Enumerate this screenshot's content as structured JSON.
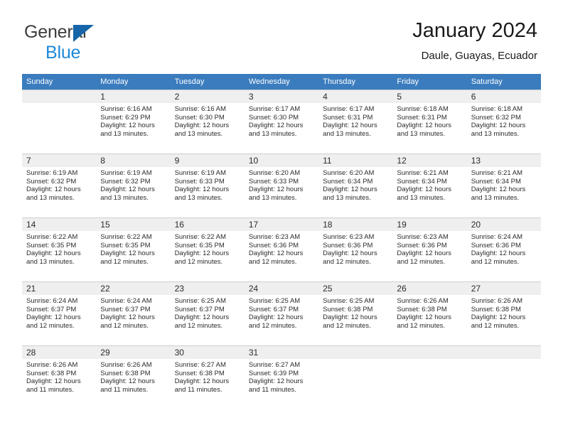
{
  "brand": {
    "line1": "General",
    "line2": "Blue",
    "triangle_color": "#1565a8",
    "blue_text_color": "#1e88d8"
  },
  "header": {
    "title": "January 2024",
    "subtitle": "Daule, Guayas, Ecuador"
  },
  "theme": {
    "header_row_bg": "#3a7cbe",
    "daynum_bg": "#efefef",
    "grid_line": "#cfcfcf"
  },
  "labels": {
    "sunrise_prefix": "Sunrise:",
    "sunset_prefix": "Sunset:",
    "daylight_prefix": "Daylight:"
  },
  "columns": [
    "Sunday",
    "Monday",
    "Tuesday",
    "Wednesday",
    "Thursday",
    "Friday",
    "Saturday"
  ],
  "weeks": [
    [
      {
        "day": "",
        "empty": true
      },
      {
        "day": "1",
        "sunrise": "Sunrise: 6:16 AM",
        "sunset": "Sunset: 6:29 PM",
        "daylight1": "Daylight: 12 hours",
        "daylight2": "and 13 minutes."
      },
      {
        "day": "2",
        "sunrise": "Sunrise: 6:16 AM",
        "sunset": "Sunset: 6:30 PM",
        "daylight1": "Daylight: 12 hours",
        "daylight2": "and 13 minutes."
      },
      {
        "day": "3",
        "sunrise": "Sunrise: 6:17 AM",
        "sunset": "Sunset: 6:30 PM",
        "daylight1": "Daylight: 12 hours",
        "daylight2": "and 13 minutes."
      },
      {
        "day": "4",
        "sunrise": "Sunrise: 6:17 AM",
        "sunset": "Sunset: 6:31 PM",
        "daylight1": "Daylight: 12 hours",
        "daylight2": "and 13 minutes."
      },
      {
        "day": "5",
        "sunrise": "Sunrise: 6:18 AM",
        "sunset": "Sunset: 6:31 PM",
        "daylight1": "Daylight: 12 hours",
        "daylight2": "and 13 minutes."
      },
      {
        "day": "6",
        "sunrise": "Sunrise: 6:18 AM",
        "sunset": "Sunset: 6:32 PM",
        "daylight1": "Daylight: 12 hours",
        "daylight2": "and 13 minutes."
      }
    ],
    [
      {
        "day": "7",
        "sunrise": "Sunrise: 6:19 AM",
        "sunset": "Sunset: 6:32 PM",
        "daylight1": "Daylight: 12 hours",
        "daylight2": "and 13 minutes."
      },
      {
        "day": "8",
        "sunrise": "Sunrise: 6:19 AM",
        "sunset": "Sunset: 6:32 PM",
        "daylight1": "Daylight: 12 hours",
        "daylight2": "and 13 minutes."
      },
      {
        "day": "9",
        "sunrise": "Sunrise: 6:19 AM",
        "sunset": "Sunset: 6:33 PM",
        "daylight1": "Daylight: 12 hours",
        "daylight2": "and 13 minutes."
      },
      {
        "day": "10",
        "sunrise": "Sunrise: 6:20 AM",
        "sunset": "Sunset: 6:33 PM",
        "daylight1": "Daylight: 12 hours",
        "daylight2": "and 13 minutes."
      },
      {
        "day": "11",
        "sunrise": "Sunrise: 6:20 AM",
        "sunset": "Sunset: 6:34 PM",
        "daylight1": "Daylight: 12 hours",
        "daylight2": "and 13 minutes."
      },
      {
        "day": "12",
        "sunrise": "Sunrise: 6:21 AM",
        "sunset": "Sunset: 6:34 PM",
        "daylight1": "Daylight: 12 hours",
        "daylight2": "and 13 minutes."
      },
      {
        "day": "13",
        "sunrise": "Sunrise: 6:21 AM",
        "sunset": "Sunset: 6:34 PM",
        "daylight1": "Daylight: 12 hours",
        "daylight2": "and 13 minutes."
      }
    ],
    [
      {
        "day": "14",
        "sunrise": "Sunrise: 6:22 AM",
        "sunset": "Sunset: 6:35 PM",
        "daylight1": "Daylight: 12 hours",
        "daylight2": "and 13 minutes."
      },
      {
        "day": "15",
        "sunrise": "Sunrise: 6:22 AM",
        "sunset": "Sunset: 6:35 PM",
        "daylight1": "Daylight: 12 hours",
        "daylight2": "and 12 minutes."
      },
      {
        "day": "16",
        "sunrise": "Sunrise: 6:22 AM",
        "sunset": "Sunset: 6:35 PM",
        "daylight1": "Daylight: 12 hours",
        "daylight2": "and 12 minutes."
      },
      {
        "day": "17",
        "sunrise": "Sunrise: 6:23 AM",
        "sunset": "Sunset: 6:36 PM",
        "daylight1": "Daylight: 12 hours",
        "daylight2": "and 12 minutes."
      },
      {
        "day": "18",
        "sunrise": "Sunrise: 6:23 AM",
        "sunset": "Sunset: 6:36 PM",
        "daylight1": "Daylight: 12 hours",
        "daylight2": "and 12 minutes."
      },
      {
        "day": "19",
        "sunrise": "Sunrise: 6:23 AM",
        "sunset": "Sunset: 6:36 PM",
        "daylight1": "Daylight: 12 hours",
        "daylight2": "and 12 minutes."
      },
      {
        "day": "20",
        "sunrise": "Sunrise: 6:24 AM",
        "sunset": "Sunset: 6:36 PM",
        "daylight1": "Daylight: 12 hours",
        "daylight2": "and 12 minutes."
      }
    ],
    [
      {
        "day": "21",
        "sunrise": "Sunrise: 6:24 AM",
        "sunset": "Sunset: 6:37 PM",
        "daylight1": "Daylight: 12 hours",
        "daylight2": "and 12 minutes."
      },
      {
        "day": "22",
        "sunrise": "Sunrise: 6:24 AM",
        "sunset": "Sunset: 6:37 PM",
        "daylight1": "Daylight: 12 hours",
        "daylight2": "and 12 minutes."
      },
      {
        "day": "23",
        "sunrise": "Sunrise: 6:25 AM",
        "sunset": "Sunset: 6:37 PM",
        "daylight1": "Daylight: 12 hours",
        "daylight2": "and 12 minutes."
      },
      {
        "day": "24",
        "sunrise": "Sunrise: 6:25 AM",
        "sunset": "Sunset: 6:37 PM",
        "daylight1": "Daylight: 12 hours",
        "daylight2": "and 12 minutes."
      },
      {
        "day": "25",
        "sunrise": "Sunrise: 6:25 AM",
        "sunset": "Sunset: 6:38 PM",
        "daylight1": "Daylight: 12 hours",
        "daylight2": "and 12 minutes."
      },
      {
        "day": "26",
        "sunrise": "Sunrise: 6:26 AM",
        "sunset": "Sunset: 6:38 PM",
        "daylight1": "Daylight: 12 hours",
        "daylight2": "and 12 minutes."
      },
      {
        "day": "27",
        "sunrise": "Sunrise: 6:26 AM",
        "sunset": "Sunset: 6:38 PM",
        "daylight1": "Daylight: 12 hours",
        "daylight2": "and 12 minutes."
      }
    ],
    [
      {
        "day": "28",
        "sunrise": "Sunrise: 6:26 AM",
        "sunset": "Sunset: 6:38 PM",
        "daylight1": "Daylight: 12 hours",
        "daylight2": "and 11 minutes."
      },
      {
        "day": "29",
        "sunrise": "Sunrise: 6:26 AM",
        "sunset": "Sunset: 6:38 PM",
        "daylight1": "Daylight: 12 hours",
        "daylight2": "and 11 minutes."
      },
      {
        "day": "30",
        "sunrise": "Sunrise: 6:27 AM",
        "sunset": "Sunset: 6:38 PM",
        "daylight1": "Daylight: 12 hours",
        "daylight2": "and 11 minutes."
      },
      {
        "day": "31",
        "sunrise": "Sunrise: 6:27 AM",
        "sunset": "Sunset: 6:39 PM",
        "daylight1": "Daylight: 12 hours",
        "daylight2": "and 11 minutes."
      },
      {
        "day": "",
        "empty": true
      },
      {
        "day": "",
        "empty": true
      },
      {
        "day": "",
        "empty": true
      }
    ]
  ]
}
